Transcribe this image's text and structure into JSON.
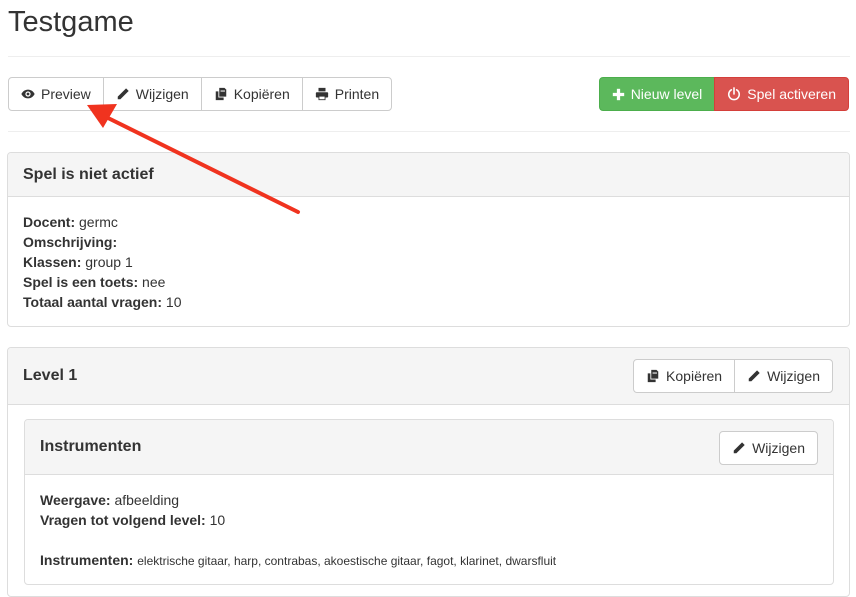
{
  "page": {
    "title": "Testgame"
  },
  "toolbar": {
    "preview_label": "Preview",
    "edit_label": "Wijzigen",
    "copy_label": "Kopiëren",
    "print_label": "Printen",
    "new_level_label": "Nieuw level",
    "activate_label": "Spel activeren"
  },
  "status_panel": {
    "title": "Spel is niet actief",
    "fields": [
      {
        "label": "Docent:",
        "value": "germc"
      },
      {
        "label": "Omschrijving:",
        "value": ""
      },
      {
        "label": "Klassen:",
        "value": "group 1"
      },
      {
        "label": "Spel is een toets:",
        "value": "nee"
      },
      {
        "label": "Totaal aantal vragen:",
        "value": "10"
      }
    ]
  },
  "level_panel": {
    "title": "Level 1",
    "copy_label": "Kopiëren",
    "edit_label": "Wijzigen",
    "inner": {
      "title": "Instrumenten",
      "edit_label": "Wijzigen",
      "fields": [
        {
          "label": "Weergave:",
          "value": "afbeelding"
        },
        {
          "label": "Vragen tot volgend level:",
          "value": "10"
        }
      ],
      "list_label": "Instrumenten:",
      "list_value": "elektrische gitaar, harp, contrabas, akoestische gitaar, fagot, klarinet, dwarsfluit"
    }
  },
  "colors": {
    "success": "#5cb85c",
    "danger": "#d9534f",
    "annotation_arrow": "#f0331f"
  }
}
